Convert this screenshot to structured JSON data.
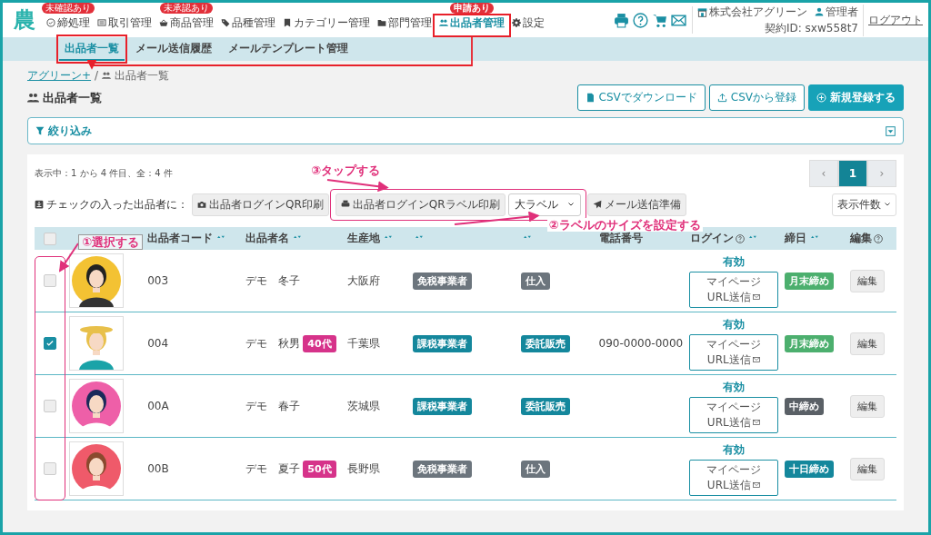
{
  "header": {
    "logo": "農",
    "nav": [
      {
        "label": "締処理",
        "badge": "未確認あり",
        "selected": false
      },
      {
        "label": "取引管理",
        "selected": false
      },
      {
        "label": "商品管理",
        "badge": "未承認あり",
        "selected": false
      },
      {
        "label": "品種管理",
        "selected": false
      },
      {
        "label": "カテゴリー管理",
        "selected": false
      },
      {
        "label": "部門管理",
        "selected": false
      },
      {
        "label": "出品者管理",
        "badge": "申請あり",
        "selected": true
      },
      {
        "label": "設定",
        "selected": false
      }
    ],
    "company": "株式会社アグリーン",
    "user": "管理者",
    "contract": "契約ID: sxw558t7",
    "logout": "ログアウト"
  },
  "subnav": [
    {
      "label": "出品者一覧",
      "selected": true
    },
    {
      "label": "メール送信履歴",
      "selected": false
    },
    {
      "label": "メールテンプレート管理",
      "selected": false
    }
  ],
  "breadcrumb": {
    "parent": "アグリーン+",
    "separator": "/",
    "current": "出品者一覧"
  },
  "title": "出品者一覧",
  "buttons": [
    "CSVでダウンロード",
    "CSVから登録",
    "新規登録する"
  ],
  "filter": {
    "label": "絞り込み"
  },
  "count": "表示中：1 から 4 件目、全：4 件",
  "pagination": [
    {
      "label": "‹",
      "selected": false
    },
    {
      "label": "1",
      "selected": true
    },
    {
      "label": "›",
      "selected": false
    }
  ],
  "bulk": {
    "label": "チェックの入った出品者に：",
    "qr_print": "出品者ログインQR印刷",
    "label_print": "出品者ログインQRラベル印刷",
    "label_size": "大ラベル",
    "mail": "メール送信準備",
    "per_page": "表示件数"
  },
  "table": {
    "select_all": {
      "checked": false
    },
    "columns": [
      {
        "label": "出品者コード",
        "sort": true
      },
      {
        "label": "出品者名",
        "sort": true
      },
      {
        "label": "生産地",
        "sort": true
      },
      {
        "sort": true
      },
      {
        "sort": true
      },
      {
        "label": "電話番号",
        "sort": false
      },
      {
        "label": "ログイン",
        "sort": true,
        "help": true
      },
      {
        "label": "締日",
        "sort": true
      },
      {
        "label": "編集",
        "sort": false,
        "help": true
      }
    ],
    "rows": [
      {
        "checked": false,
        "code": "003",
        "name": "デモ　冬子",
        "pref": "大阪府",
        "tax": {
          "text": "免税事業者",
          "color": "#6c757d"
        },
        "form": {
          "text": "仕入",
          "color": "#6c757d"
        },
        "login_status": "有効",
        "login_button": [
          "マイページ",
          "URL送信"
        ],
        "closing": {
          "text": "月末締め",
          "color": "#4caf6e"
        },
        "edit": "編集"
      },
      {
        "checked": true,
        "code": "004",
        "name": "デモ　秋男",
        "age": "40代",
        "pref": "千葉県",
        "tax": {
          "text": "課税事業者",
          "color": "#14879c"
        },
        "form": {
          "text": "委託販売",
          "color": "#14879c"
        },
        "phone": "090-0000-0000",
        "login_status": "有効",
        "login_button": [
          "マイページ",
          "URL送信"
        ],
        "closing": {
          "text": "月末締め",
          "color": "#4caf6e"
        },
        "edit": "編集"
      },
      {
        "checked": false,
        "code": "00A",
        "name": "デモ　春子",
        "pref": "茨城県",
        "tax": {
          "text": "課税事業者",
          "color": "#14879c"
        },
        "form": {
          "text": "委託販売",
          "color": "#14879c"
        },
        "login_status": "有効",
        "login_button": [
          "マイページ",
          "URL送信"
        ],
        "closing": {
          "text": "中締め",
          "color": "#5a6066"
        },
        "edit": "編集"
      },
      {
        "checked": false,
        "code": "00B",
        "name": "デモ　夏子",
        "age": "50代",
        "pref": "長野県",
        "tax": {
          "text": "免税事業者",
          "color": "#6c757d"
        },
        "form": {
          "text": "仕入",
          "color": "#6c757d"
        },
        "login_status": "有効",
        "login_button": [
          "マイページ",
          "URL送信"
        ],
        "closing": {
          "text": "十日締め",
          "color": "#14879c"
        },
        "edit": "編集"
      }
    ]
  },
  "annotations": [
    {
      "text": "①選択する"
    },
    {
      "text": "②ラベルのサイズを設定する"
    },
    {
      "text": "③タップする"
    }
  ]
}
